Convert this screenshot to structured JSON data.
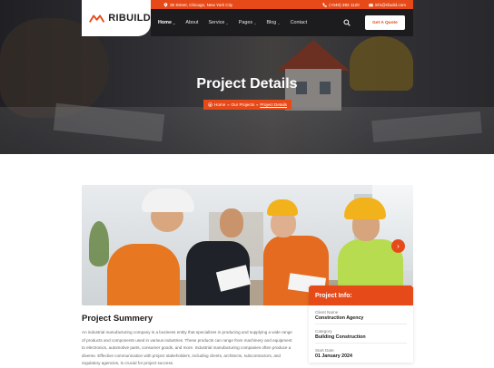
{
  "brand": {
    "name": "RIBUILD",
    "accent": "#e64a19"
  },
  "topbar": {
    "address": "36 Street, Chicago, New York City",
    "phone": "(+040) 392 1120",
    "email": "info@ribuild.com"
  },
  "nav": {
    "items": [
      {
        "label": "Home",
        "has_dropdown": true,
        "active": true
      },
      {
        "label": "About",
        "has_dropdown": false,
        "active": false
      },
      {
        "label": "Service",
        "has_dropdown": true,
        "active": false
      },
      {
        "label": "Pages",
        "has_dropdown": true,
        "active": false
      },
      {
        "label": "Blog",
        "has_dropdown": true,
        "active": false
      },
      {
        "label": "Contact",
        "has_dropdown": false,
        "active": false
      }
    ],
    "cta": "Get A Quote",
    "chevron": "⌄"
  },
  "hero": {
    "title": "Project Details",
    "breadcrumb": {
      "home": "Home",
      "parent": "Our Projects",
      "current": "Project Details"
    }
  },
  "project_info": {
    "title": "Project Info:",
    "fields": [
      {
        "label": "Client Name",
        "value": "Construction Agency"
      },
      {
        "label": "Category",
        "value": "Building Construction"
      },
      {
        "label": "Start Date",
        "value": "01 January 2024"
      }
    ]
  },
  "summary": {
    "title": "Project Summery",
    "text": "An industrial manufacturing company is a business entity that specializes in producing and supplying a wide range of products and components used in various industries. These products can range from machinery and equipment to electronics, automotive parts, consumer goods, and more. Industrial manufacturing companies often produce a diverse. Effective communication with project stakeholders, including clients, architects, subcontractors, and regulatory agencies, is crucial for project success."
  },
  "icons": {
    "location": "location-pin-icon",
    "phone": "phone-icon",
    "email": "email-icon",
    "search": "search-icon",
    "home": "home-icon",
    "next": "arrow-right-icon"
  }
}
